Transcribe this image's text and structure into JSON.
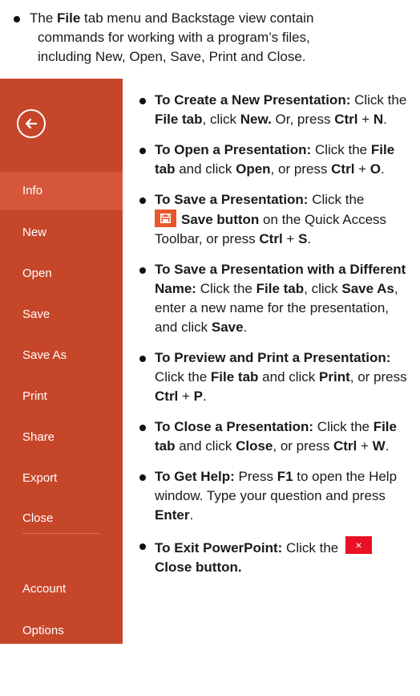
{
  "intro": {
    "pre": "The ",
    "bold": "File",
    "post": " tab menu and Backstage view contain",
    "line2": "commands for working with a program’s files,",
    "line3": "including New, Open, Save, Print and Close."
  },
  "backstage": {
    "back_icon": "back-arrow-icon",
    "nav": [
      {
        "label": "Info",
        "active": true
      },
      {
        "label": "New"
      },
      {
        "label": "Open"
      },
      {
        "label": "Save"
      },
      {
        "label": "Save As"
      },
      {
        "label": "Print"
      },
      {
        "label": "Share"
      },
      {
        "label": "Export"
      },
      {
        "label": "Close"
      },
      {
        "label": "Account"
      },
      {
        "label": "Options"
      }
    ],
    "colors": {
      "panel": "#c6462a",
      "active": "#d6573a"
    }
  },
  "items": {
    "create": {
      "title": "To Create a New Presentation:",
      "t1": " Click the ",
      "b1": "File tab",
      ",": "",
      "t2": ", click ",
      "b2": "New.",
      "t3": " Or, press ",
      "b3": "Ctrl",
      "t4": " + ",
      "b4": "N",
      "t5": "."
    },
    "open": {
      "title": "To Open a Presentation:",
      "t1": " Click the ",
      "b1": "File tab",
      "t2": " and click ",
      "b2": "Open",
      "t3": ", or press ",
      "b3": "Ctrl",
      "t4": " + ",
      "b4": "O",
      "t5": "."
    },
    "save": {
      "title": "To Save a Presentation:",
      "t1": " Click the ",
      "b1": "Save button",
      "t2": " on the Quick Access Toolbar, or press ",
      "b2": "Ctrl",
      "t3": " + ",
      "b3": "S",
      "t4": "."
    },
    "saveas": {
      "title": "To Save a Presentation with a Different Name:",
      "t1": " Click the ",
      "b1": "File tab",
      "t2": ", click ",
      "b2": "Save As",
      "t3": ", enter a new name for the presentation, and click ",
      "b3": "Save",
      "t4": "."
    },
    "print": {
      "title": "To Preview and Print a Presentation:",
      "t1": " Click the ",
      "b1": "File tab",
      "t2": " and click ",
      "b2": "Print",
      "t3": ", or press ",
      "b3": "Ctrl",
      "t4": " + ",
      "b4": "P",
      "t5": "."
    },
    "close": {
      "title": "To Close a Presentation:",
      "t1": " Click the ",
      "b1": "File tab",
      "t2": " and click ",
      "b2": "Close",
      "t3": ", or press ",
      "b3": "Ctrl",
      "t4": " + ",
      "b4": "W",
      "t5": "."
    },
    "help": {
      "title": "To Get Help:",
      "t1": " Press ",
      "b1": "F1",
      "t2": " to open the Help window. Type your question and press ",
      "b2": "Enter",
      "t3": "."
    },
    "exit": {
      "title": "To Exit PowerPoint:",
      "t1": " Click the ",
      "b1": "Close button."
    }
  },
  "icons": {
    "save": "save-disk-icon",
    "close": "close-x-icon",
    "close_glyph": "×"
  }
}
